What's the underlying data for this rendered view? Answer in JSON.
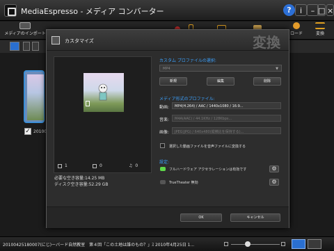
{
  "app": {
    "title": "MediaEspresso ‐ メディア コンバーター",
    "help_label": "?",
    "info_label": "i",
    "minimize_label": "–",
    "maximize_label": "□",
    "close_label": "×"
  },
  "toolbar": {
    "import_label": "メディアのインポート",
    "download_label": "ロード",
    "convert_label": "変換"
  },
  "library": {
    "item_label": "20100",
    "item_checked": true
  },
  "dialog": {
    "title": "カスタマイズ",
    "watermark": "変換",
    "preview": {
      "video_count": "1",
      "photo_count": "0",
      "music_count": "0",
      "required_space": "必要な空き容量:14.25 MB",
      "free_space": "ディスク空き容量:52.29 GB"
    },
    "custom_profile": {
      "heading": "カスタム プロファイルの選択:",
      "selected": "MP4",
      "new_label": "新規",
      "edit_label": "編集",
      "delete_label": "削除"
    },
    "format_profile": {
      "heading": "メディア形式のプロファイル:",
      "video_label": "動画:",
      "video_value": "MP4(H.264) / AAC / 1440x1080 / 16:9...",
      "audio_label": "音楽:",
      "audio_value": "M4A(AAC) / 44.1KHz / 128Kbps...",
      "image_label": "画像:",
      "image_value": "JPEG(JPG) / 640x480(縦横比を保持する)...",
      "convert_audio_label": "選択した動画ファイルを音声ファイルに変換する"
    },
    "settings": {
      "heading": "設定:",
      "hw_accel_label": "フルハードウェア アクセラレーションは有効です",
      "hw_accel_on": true,
      "trutheater_label": "TrueTheater 無効",
      "trutheater_on": false
    },
    "ok_label": "OK",
    "cancel_label": "キャンセル"
  },
  "status": {
    "text": "20100425180007(にじ)ーバード自然教室　第４回「この土地は誰のもの？」ｽ 2010年4月25日 1..."
  },
  "colors": {
    "accent": "#3ca2ff",
    "led_on": "#5fd84a",
    "led_off": "#555555",
    "selection": "#2a6fd0"
  }
}
